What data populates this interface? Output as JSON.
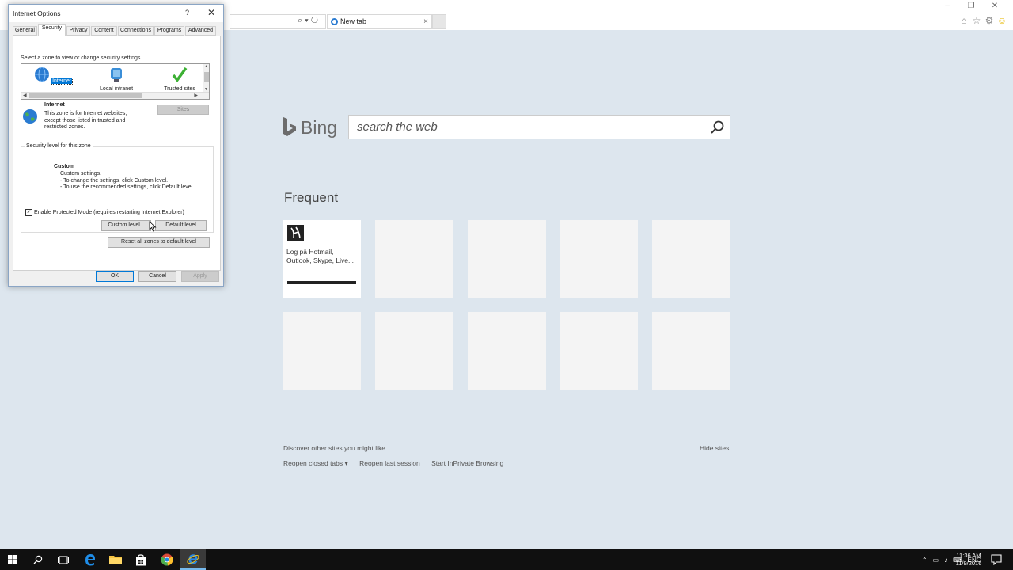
{
  "browser": {
    "tab_title": "New tab",
    "tab_close": "×",
    "window_controls": [
      "–",
      "❐",
      "✕"
    ]
  },
  "newtab": {
    "bing_label": "Bing",
    "search_placeholder": "search the web",
    "frequent_title": "Frequent",
    "tile1_label": "Log på Hotmail, Outlook, Skype, Live...",
    "discover": "Discover other sites you might like",
    "hide_sites": "Hide sites",
    "reopen_closed": "Reopen closed tabs ▾",
    "reopen_session": "Reopen last session",
    "inprivate": "Start InPrivate Browsing"
  },
  "dialog": {
    "title": "Internet Options",
    "help": "?",
    "close": "✕",
    "tabs": [
      "General",
      "Security",
      "Privacy",
      "Content",
      "Connections",
      "Programs",
      "Advanced"
    ],
    "zone_prompt": "Select a zone to view or change security settings.",
    "zones": [
      "Internet",
      "Local intranet",
      "Trusted sites"
    ],
    "zone_name": "Internet",
    "zone_desc": "This zone is for Internet websites, except those listed in trusted and restricted zones.",
    "sites_button": "Sites",
    "security_level_legend": "Security level for this zone",
    "level_name": "Custom",
    "level_desc_1": "Custom settings.",
    "level_desc_2": "- To change the settings, click Custom level.",
    "level_desc_3": "- To use the recommended settings, click Default level.",
    "protected_mode": "Enable Protected Mode (requires restarting Internet Explorer)",
    "protected_mode_checked": true,
    "custom_level": "Custom level...",
    "default_level": "Default level",
    "reset_all": "Reset all zones to default level",
    "ok": "OK",
    "cancel": "Cancel",
    "apply": "Apply"
  },
  "taskbar": {
    "language": "ENG",
    "time": "11:36 AM",
    "date": "11/9/2016"
  },
  "colors": {
    "page_bg": "#dde6ee",
    "accent": "#0078d7",
    "taskbar": "#101010"
  }
}
